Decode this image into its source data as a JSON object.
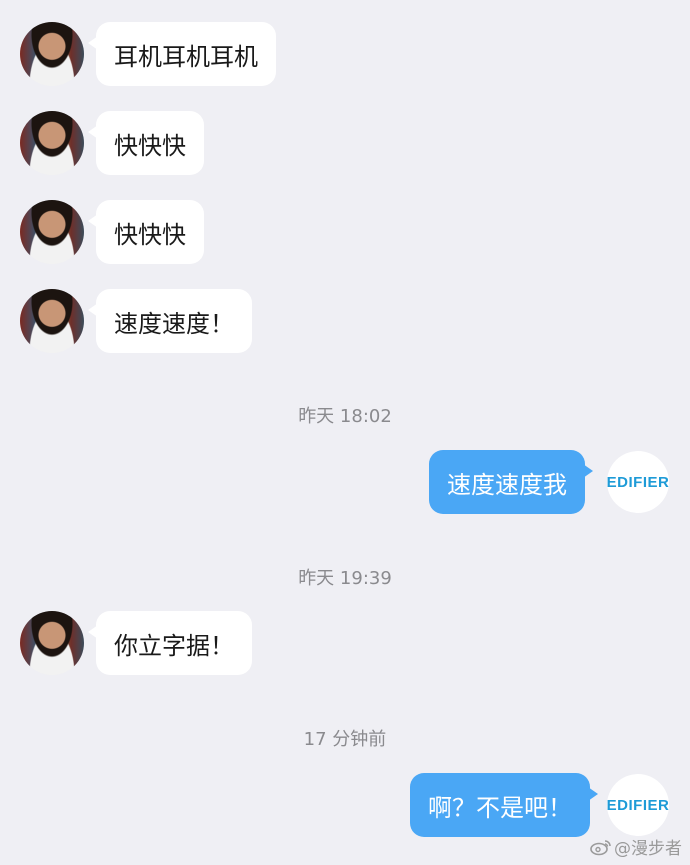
{
  "messages": {
    "m1": "耳机耳机耳机",
    "m2": "快快快",
    "m3": "快快快",
    "m4": "速度速度！",
    "m5": "速度速度我",
    "m6": "你立字据！",
    "m7": "啊？不是吧！"
  },
  "timestamps": {
    "t1": "昨天 18:02",
    "t2": "昨天 19:39",
    "t3": "17 分钟前"
  },
  "brand": {
    "avatar_text": "EDIFIER"
  },
  "watermark": {
    "text": "@漫步者"
  },
  "colors": {
    "background": "#efeff4",
    "outgoing_bubble": "#4aa7f5",
    "incoming_bubble": "#ffffff",
    "brand_blue": "#1e9bd7"
  }
}
